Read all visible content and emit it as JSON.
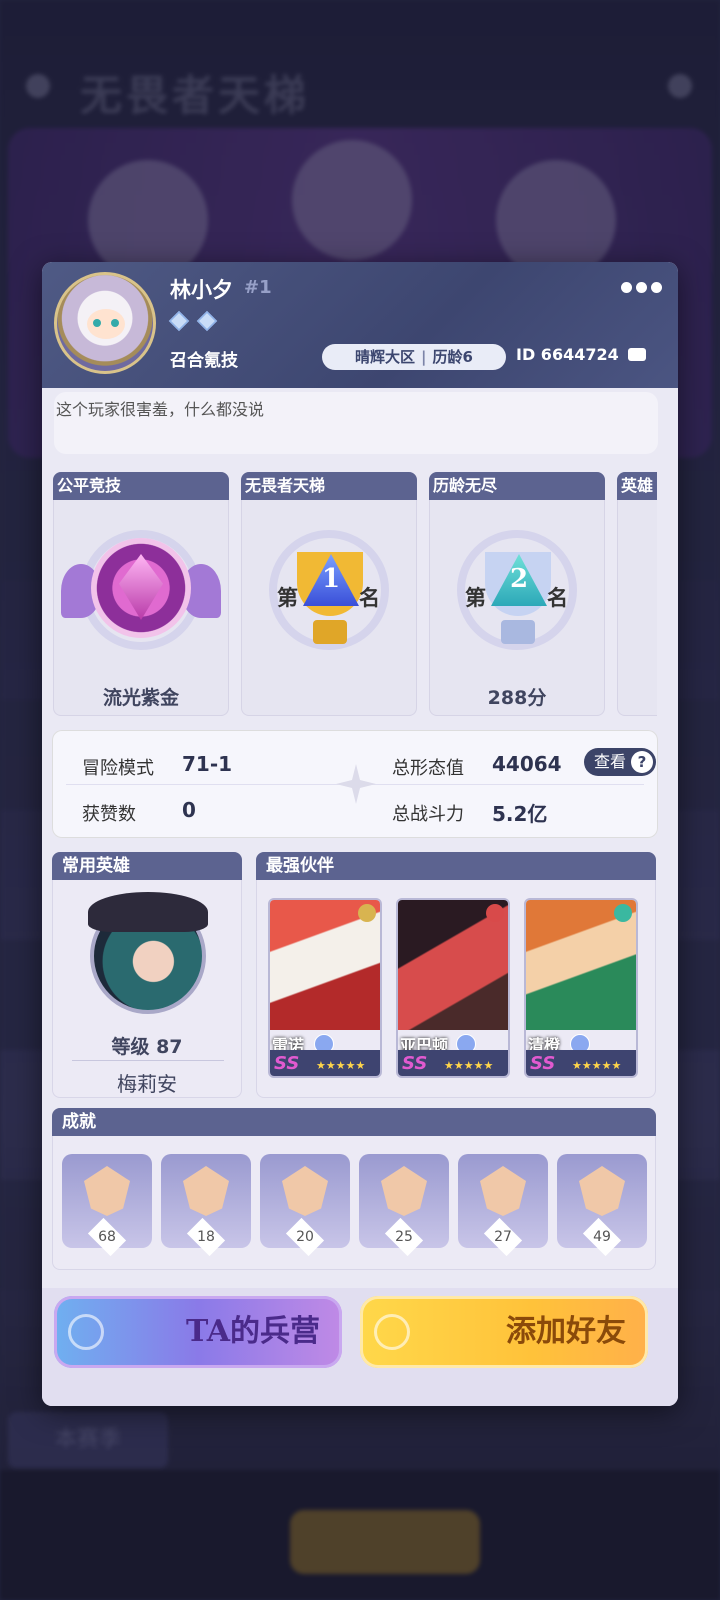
{
  "background": {
    "title": "无畏者天梯",
    "tab": "本赛季"
  },
  "player": {
    "name": "林小夕",
    "rank_tag": "#1",
    "title": "召合氪技",
    "region": "晴辉大区",
    "age": "历龄6",
    "id": "ID 6644724",
    "bio": "这个玩家很害羞，什么都没说"
  },
  "rank_tiles": [
    {
      "label": "公平竞技",
      "value": "流光紫金"
    },
    {
      "label": "无畏者天梯",
      "place": "1",
      "di": "第",
      "ming": "名",
      "value": ""
    },
    {
      "label": "历龄无尽",
      "place": "2",
      "di": "第",
      "ming": "名",
      "value": "288分"
    },
    {
      "label": "英雄"
    }
  ],
  "stats": {
    "adventure_label": "冒险模式",
    "adventure_value": "71-1",
    "form_label": "总形态值",
    "form_value": "44064",
    "likes_label": "获赞数",
    "likes_value": "0",
    "power_label": "总战斗力",
    "power_value": "5.2亿",
    "view_label": "查看"
  },
  "hero": {
    "header": "常用英雄",
    "level": "等级 87",
    "name": "梅莉安"
  },
  "partners": {
    "header": "最强伙伴",
    "items": [
      {
        "name": "雷诺",
        "grade": "SS",
        "stars": "★★★★★"
      },
      {
        "name": "亚巴顿",
        "grade": "SS",
        "stars": "★★★★★"
      },
      {
        "name": "清橙",
        "grade": "SS",
        "stars": "★★★★★"
      }
    ]
  },
  "achievements": {
    "header": "成就",
    "items": [
      "68",
      "18",
      "20",
      "25",
      "27",
      "49"
    ]
  },
  "buttons": {
    "barracks": "TA的兵营",
    "add_friend": "添加好友"
  },
  "colors": {
    "header_bar": "#5c6390",
    "card_bg": "#eae9f4"
  }
}
